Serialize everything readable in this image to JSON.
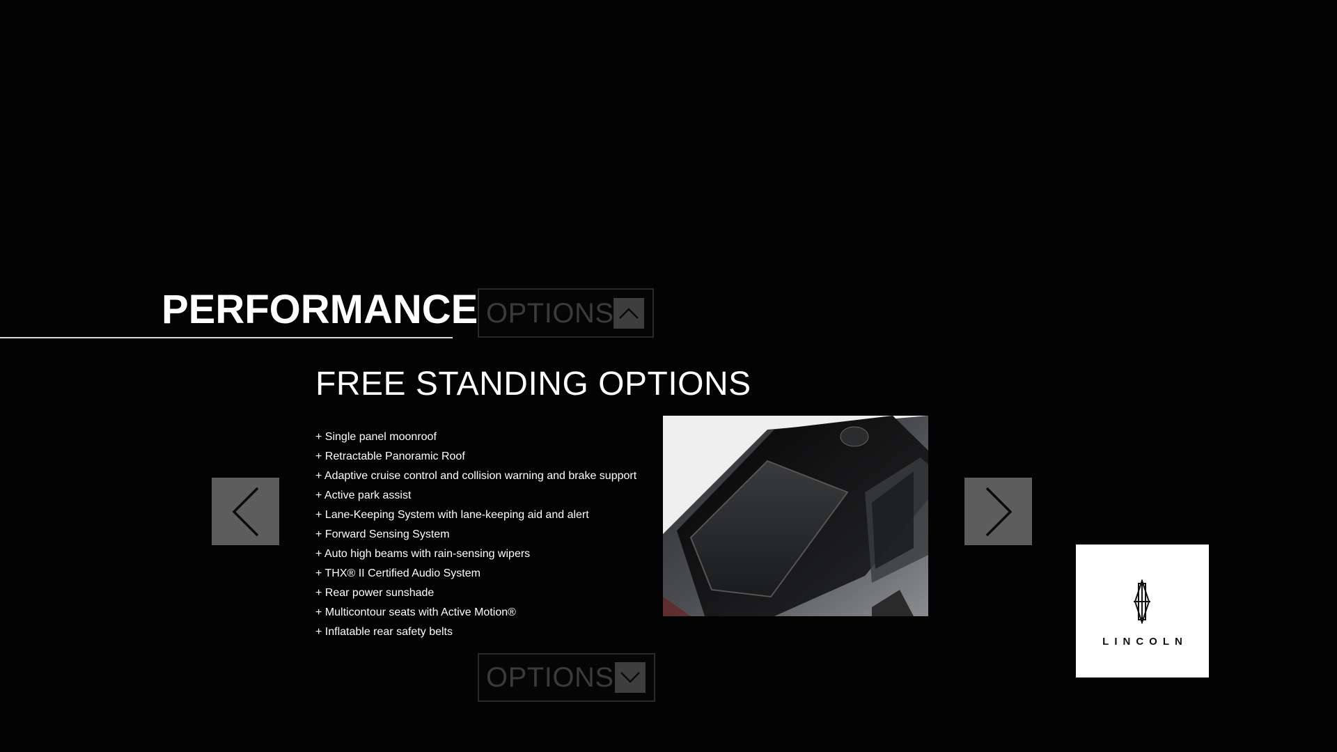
{
  "section": {
    "title": "PERFORMANCE"
  },
  "options_top": {
    "label": "OPTIONS",
    "toggle_icon": "chevron-up-icon"
  },
  "options_bottom": {
    "label": "OPTIONS",
    "toggle_icon": "chevron-down-icon"
  },
  "content": {
    "heading": "FREE STANDING OPTIONS",
    "features": [
      "+ Single panel moonroof",
      "+ Retractable Panoramic Roof",
      "+ Adaptive cruise control and collision warning and brake support",
      "+ Active park assist",
      "+ Lane-Keeping System with lane-keeping aid and alert",
      "+ Forward Sensing System",
      "+ Auto high beams with rain-sensing wipers",
      "+ THX® II Certified Audio System",
      "+ Rear power sunshade",
      "+ Multicontour seats with Active Motion®",
      "+ Inflatable rear safety belts"
    ]
  },
  "navigation": {
    "prev_icon": "chevron-left-icon",
    "next_icon": "chevron-right-icon"
  },
  "brand": {
    "wordmark": "LINCOLN",
    "emblem_icon": "lincoln-star-emblem-icon"
  },
  "colors": {
    "background": "#030303",
    "text": "#ffffff",
    "nav_button": "#5d5d5d",
    "options_text": "#3a3a3a",
    "options_toggle": "#3e3e3e"
  }
}
